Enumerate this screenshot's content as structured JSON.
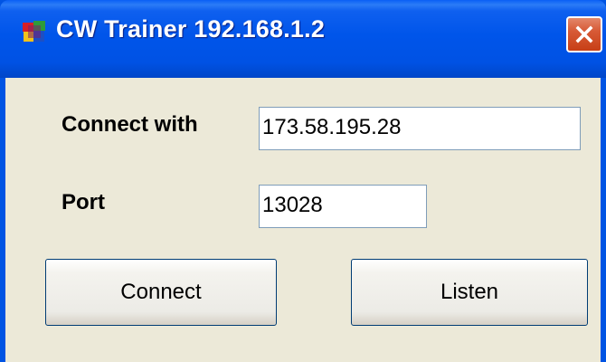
{
  "window": {
    "title": "CW Trainer 192.168.1.2",
    "app_icon": "cw-trainer-app-icon",
    "close_icon": "close-icon"
  },
  "form": {
    "connect_with_label": "Connect with",
    "connect_with_value": "173.58.195.28",
    "port_label": "Port",
    "port_value": "13028"
  },
  "buttons": {
    "connect_label": "Connect",
    "listen_label": "Listen"
  },
  "colors": {
    "titlebar": "#0054e3",
    "client_background": "#ece9d8",
    "close_button": "#d75a36"
  }
}
